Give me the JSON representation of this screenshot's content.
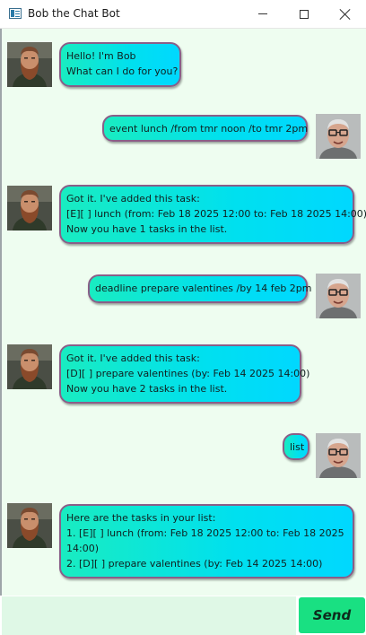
{
  "window": {
    "title": "Bob the Chat Bot",
    "icon": "app-window-icon",
    "controls": [
      "minimize-icon",
      "maximize-icon",
      "close-icon"
    ]
  },
  "colors": {
    "chat_background": "#eefdf0",
    "bubble_gradient_start": "#19ecc1",
    "bubble_gradient_end": "#00d8ff",
    "bubble_border": "#8a5e88",
    "send_button": "#19e082",
    "input_background": "#dff8e6"
  },
  "messages": [
    {
      "sender": "bot",
      "lines": [
        "Hello! I'm Bob",
        "What can I do for you?"
      ]
    },
    {
      "sender": "user",
      "lines": [
        "event lunch /from tmr noon /to tmr 2pm"
      ]
    },
    {
      "sender": "bot",
      "lines": [
        "Got it. I've added this task:",
        "[E][ ] lunch  (from: Feb 18 2025 12:00 to: Feb 18 2025 14:00)",
        "Now you have 1 tasks in the list."
      ]
    },
    {
      "sender": "user",
      "lines": [
        "deadline prepare valentines /by 14 feb 2pm"
      ]
    },
    {
      "sender": "bot",
      "lines": [
        "Got it. I've added this task:",
        "[D][ ] prepare valentines  (by: Feb 14 2025 14:00)",
        "Now you have 2 tasks in the list."
      ]
    },
    {
      "sender": "user",
      "lines": [
        "list"
      ]
    },
    {
      "sender": "bot",
      "lines": [
        "Here are the tasks in your list:",
        "1. [E][ ] lunch  (from: Feb 18 2025 12:00 to: Feb 18 2025",
        "14:00)",
        "2. [D][ ] prepare valentines  (by: Feb 14 2025 14:00)"
      ]
    }
  ],
  "input": {
    "value": "",
    "placeholder": ""
  },
  "send_button": {
    "label": "Send"
  }
}
